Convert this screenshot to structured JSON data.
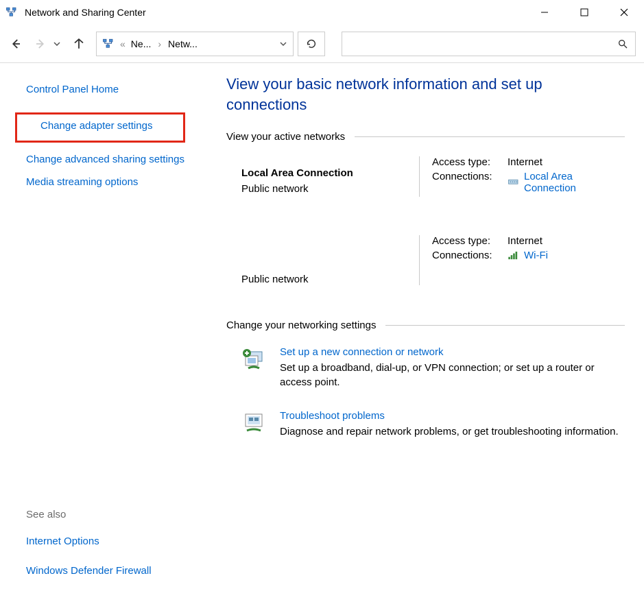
{
  "window_title": "Network and Sharing Center",
  "breadcrumb": {
    "seg1": "Ne...",
    "seg2": "Netw..."
  },
  "sidebar": {
    "home": "Control Panel Home",
    "links": [
      "Change adapter settings",
      "Change advanced sharing settings",
      "Media streaming options"
    ],
    "see_also_label": "See also",
    "see_also": [
      "Internet Options",
      "Windows Defender Firewall"
    ]
  },
  "page_title": "View your basic network information and set up connections",
  "active_networks_header": "View your active networks",
  "networks": [
    {
      "name": "Local Area Connection",
      "type": "Public network",
      "access_label": "Access type:",
      "access_value": "Internet",
      "conn_label": "Connections:",
      "conn_value": "Local Area Connection"
    },
    {
      "name": "",
      "type": "Public network",
      "access_label": "Access type:",
      "access_value": "Internet",
      "conn_label": "Connections:",
      "conn_value": "Wi-Fi"
    }
  ],
  "change_settings_header": "Change your networking settings",
  "settings": [
    {
      "title": "Set up a new connection or network",
      "desc": "Set up a broadband, dial-up, or VPN connection; or set up a router or access point."
    },
    {
      "title": "Troubleshoot problems",
      "desc": "Diagnose and repair network problems, or get troubleshooting information."
    }
  ]
}
